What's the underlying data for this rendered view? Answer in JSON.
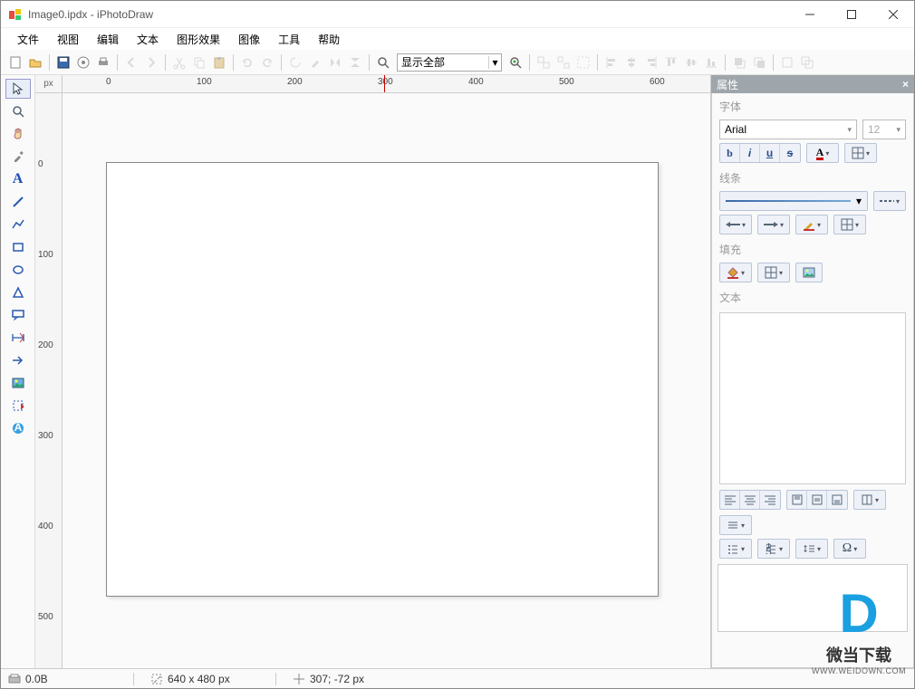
{
  "window": {
    "title": "Image0.ipdx - iPhotoDraw"
  },
  "menu": {
    "file": "文件",
    "view": "视图",
    "edit": "编辑",
    "text": "文本",
    "effects": "图形效果",
    "image": "图像",
    "tools": "工具",
    "help": "帮助"
  },
  "toolbar": {
    "zoom_label": "显示全部"
  },
  "ruler": {
    "unit": "px",
    "h": [
      "0",
      "100",
      "200",
      "300",
      "400",
      "500",
      "600"
    ],
    "v": [
      "0",
      "100",
      "200",
      "300",
      "400",
      "500"
    ]
  },
  "props": {
    "title": "属性",
    "font_section": "字体",
    "font_name": "Arial",
    "font_size": "12",
    "line_section": "线条",
    "fill_section": "填充",
    "text_section": "文本"
  },
  "status": {
    "filesize": "0.0B",
    "dimensions": "640 x 480 px",
    "cursor": "307; -72 px"
  },
  "watermark": {
    "logo": "D",
    "cn": "微当下载",
    "url": "WWW.WEIDOWN.COM"
  }
}
